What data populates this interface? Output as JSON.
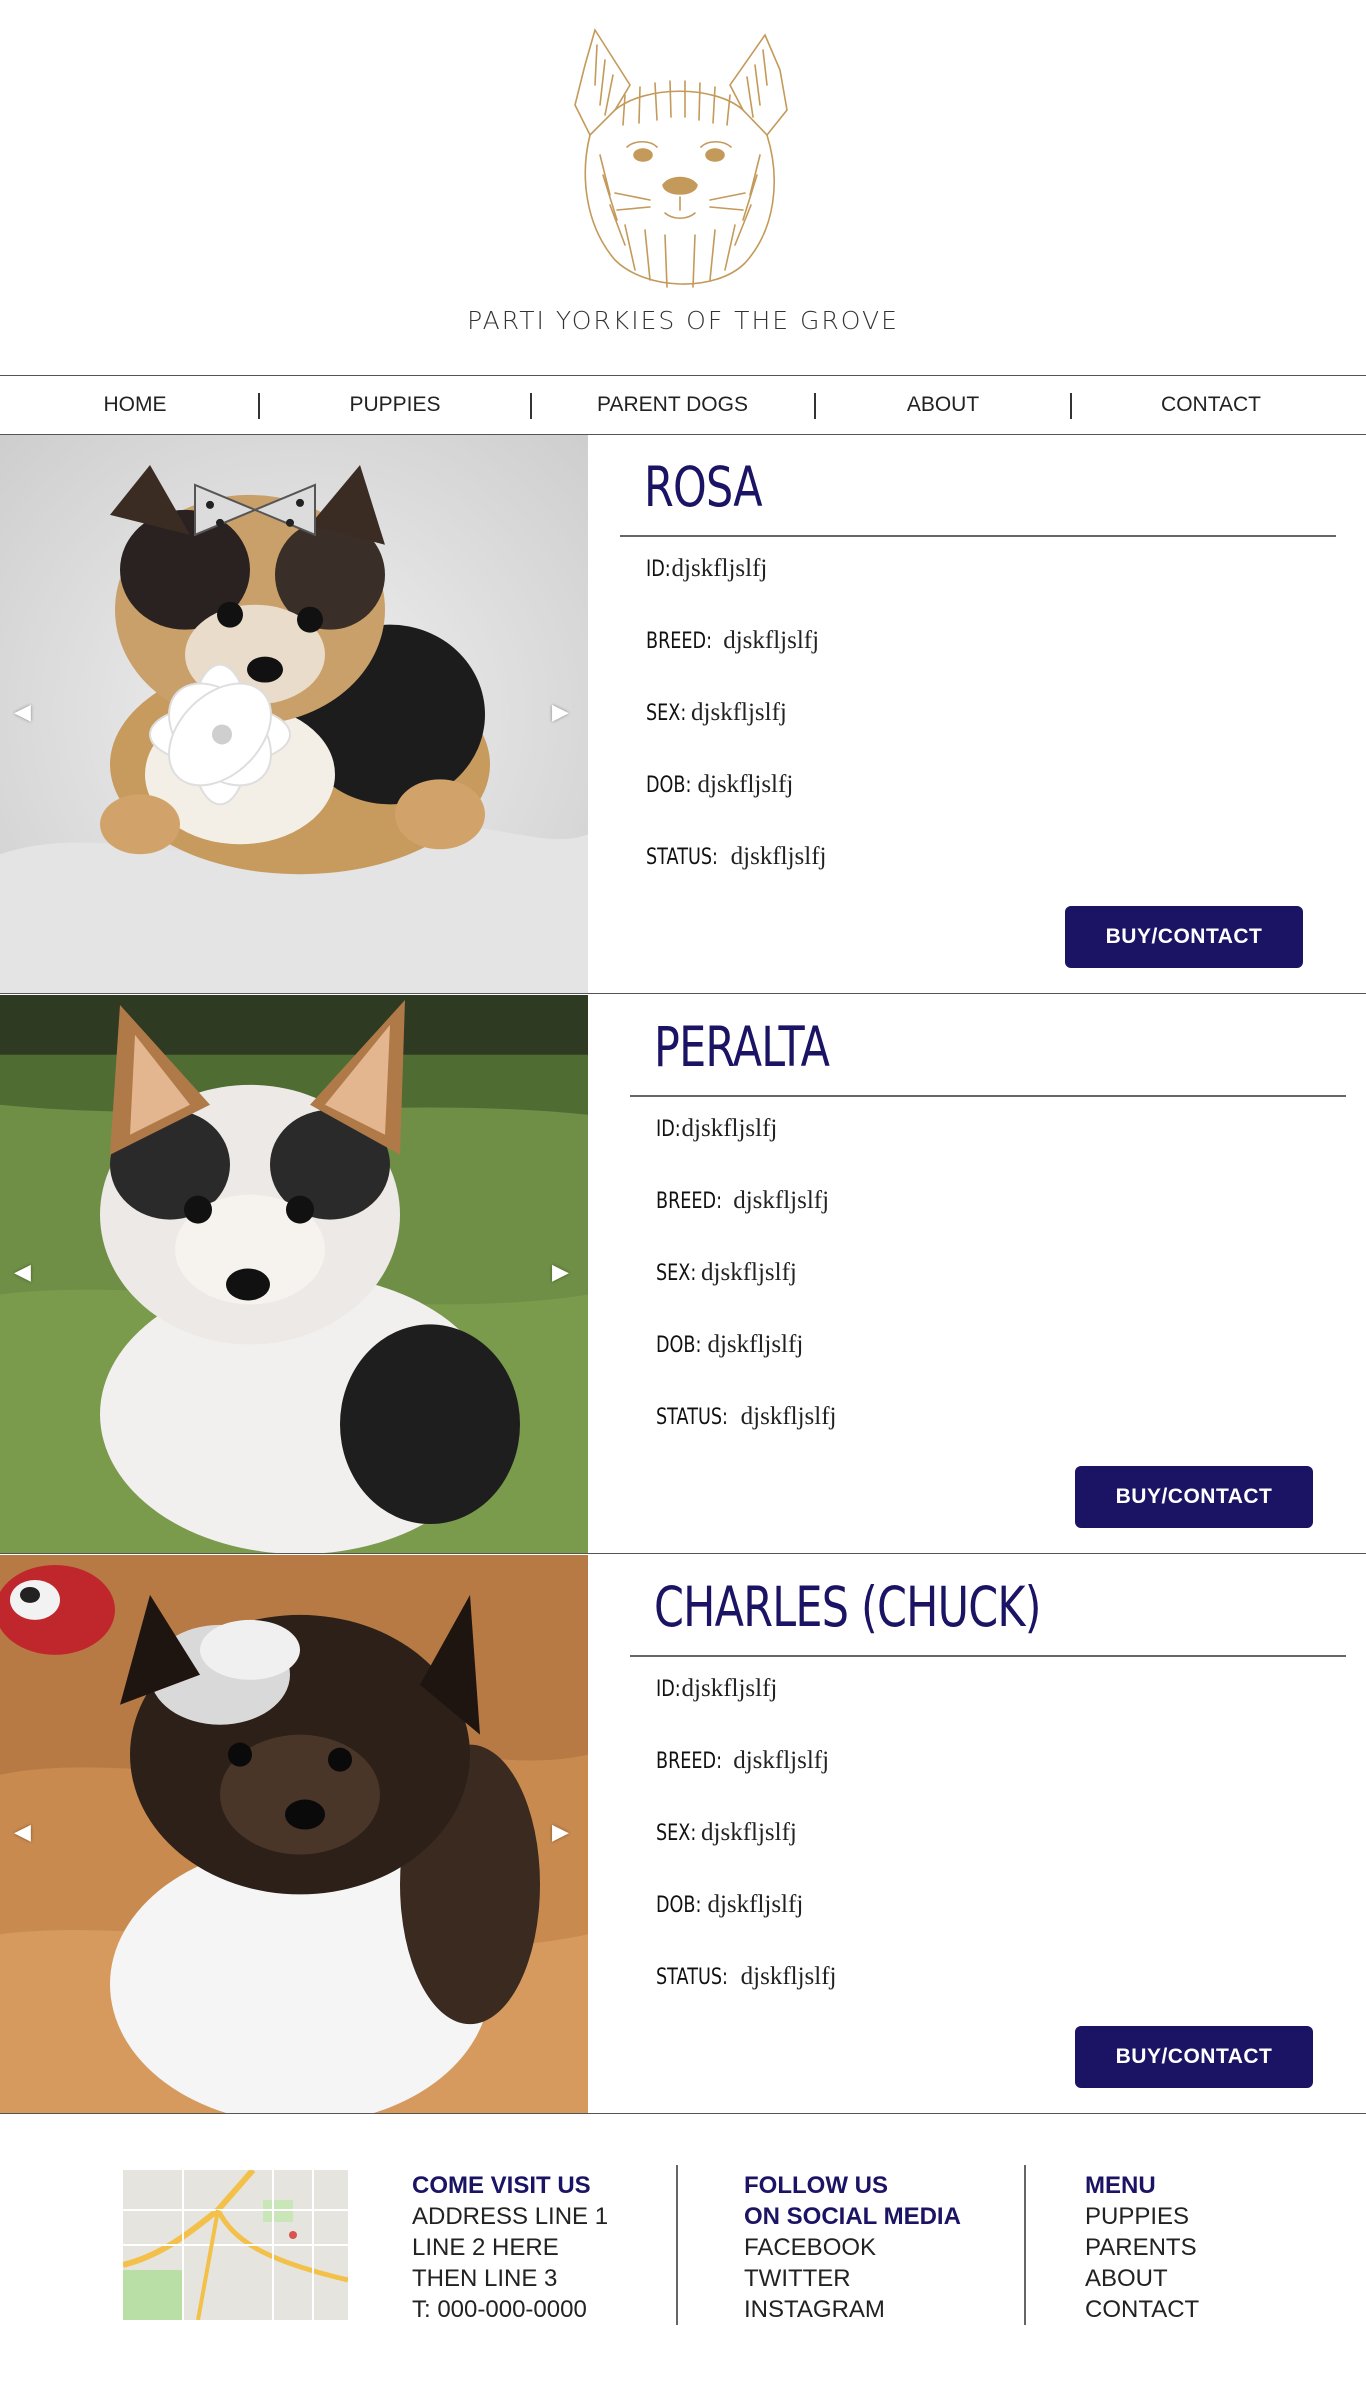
{
  "site": {
    "title": "PARTI YORKIES OF THE GROVE"
  },
  "nav": {
    "items": [
      "HOME",
      "PUPPIES",
      "PARENT DOGS",
      "ABOUT",
      "CONTACT"
    ]
  },
  "colors": {
    "accent": "#1b1464",
    "logo": "#c49a5a"
  },
  "puppies": [
    {
      "name": "ROSA",
      "fields": [
        {
          "label": "ID:",
          "value": "djskfljslfj"
        },
        {
          "label": "BREED:",
          "value": "djskfljslfj"
        },
        {
          "label": "SEX:",
          "value": "djskfljslfj"
        },
        {
          "label": "DOB:",
          "value": "djskfljslfj"
        },
        {
          "label": "STATUS:",
          "value": "djskfljslfj"
        }
      ],
      "button": "BUY/CONTACT"
    },
    {
      "name": "PERALTA",
      "fields": [
        {
          "label": "ID:",
          "value": "djskfljslfj"
        },
        {
          "label": "BREED:",
          "value": "djskfljslfj"
        },
        {
          "label": "SEX:",
          "value": "djskfljslfj"
        },
        {
          "label": "DOB:",
          "value": "djskfljslfj"
        },
        {
          "label": "STATUS:",
          "value": "djskfljslfj"
        }
      ],
      "button": "BUY/CONTACT"
    },
    {
      "name": "CHARLES (CHUCK)",
      "fields": [
        {
          "label": "ID:",
          "value": "djskfljslfj"
        },
        {
          "label": "BREED:",
          "value": "djskfljslfj"
        },
        {
          "label": "SEX:",
          "value": "djskfljslfj"
        },
        {
          "label": "DOB:",
          "value": "djskfljslfj"
        },
        {
          "label": "STATUS:",
          "value": "djskfljslfj"
        }
      ],
      "button": "BUY/CONTACT"
    }
  ],
  "arrows": {
    "left": "◀",
    "right": "▶"
  },
  "footer": {
    "visit": {
      "heading": "COME VISIT US",
      "lines": [
        "ADDRESS LINE 1",
        "LINE 2 HERE",
        "THEN LINE 3",
        "T: 000-000-0000"
      ]
    },
    "social": {
      "heading_1": "FOLLOW US",
      "heading_2": "ON SOCIAL MEDIA",
      "links": [
        "FACEBOOK",
        "TWITTER",
        "INSTAGRAM"
      ]
    },
    "menu": {
      "heading": "MENU",
      "links": [
        "PUPPIES",
        "PARENTS",
        "ABOUT",
        "CONTACT"
      ]
    }
  }
}
